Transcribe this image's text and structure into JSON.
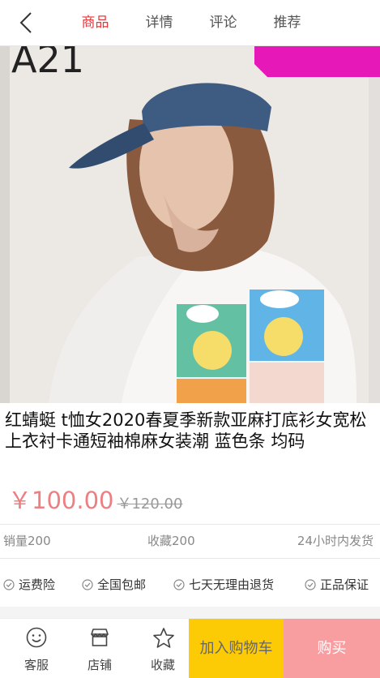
{
  "nav": {
    "tabs": [
      {
        "label": "商品",
        "active": true
      },
      {
        "label": "详情",
        "active": false
      },
      {
        "label": "评论",
        "active": false
      },
      {
        "label": "推荐",
        "active": false
      }
    ]
  },
  "product": {
    "title": "红蜻蜓 t恤女2020春夏季新款亚麻打底衫女宽松上衣衬卡通短袖棉麻女装潮 蓝色条 均码",
    "price": "￥100.00",
    "old_price": "￥120.00",
    "image_text": "A21"
  },
  "stats": {
    "sales": "销量200",
    "favorites": "收藏200",
    "shipping": "24小时内发货"
  },
  "services": [
    {
      "label": "运费险"
    },
    {
      "label": "全国包邮"
    },
    {
      "label": "七天无理由退货"
    },
    {
      "label": "正品保证"
    }
  ],
  "bottom": {
    "service_label": "客服",
    "shop_label": "店铺",
    "favorite_label": "收藏",
    "cart_label": "加入购物车",
    "buy_label": "购买"
  },
  "colors": {
    "accent": "#e4393c",
    "price": "#ec7f82",
    "cart": "#fdcb06",
    "buy": "#f89ea1"
  }
}
